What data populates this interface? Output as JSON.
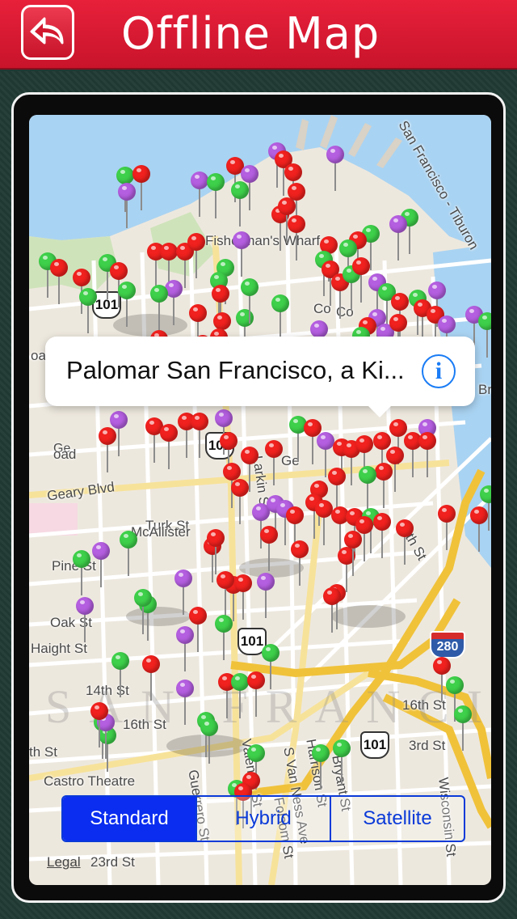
{
  "header": {
    "title": "Offline Map",
    "back_icon": "back-arrow-icon"
  },
  "callout": {
    "title": "Palomar San Francisco, a Ki...",
    "info_icon": "i"
  },
  "segments": [
    {
      "label": "Standard",
      "active": true
    },
    {
      "label": "Hybrid",
      "active": false
    },
    {
      "label": "Satellite",
      "active": false
    }
  ],
  "map": {
    "district_label": "SAN FRANCISCO",
    "legal": "Legal",
    "streets": [
      "Fisherman's Wharf",
      "Pine St",
      "Geary Blvd",
      "Turk St",
      "McAllister",
      "Oak St",
      "Haight St",
      "14th St",
      "16th St",
      "Castro Theatre",
      "23rd St",
      "Guerrero St",
      "Valencia St",
      "S Van Ness Ave",
      "Harrison St",
      "Bryant St",
      "Folsom St",
      "Wisconsin St",
      "San Francisco - Tiburon",
      "16th St",
      "Bro",
      "Larkin St",
      "Ge",
      "Co",
      "th St",
      "5th St",
      "oad",
      "3rd St"
    ],
    "highway_shields": [
      "101",
      "101",
      "101",
      "280"
    ]
  },
  "colors": {
    "header": "#d81a31",
    "pin_red": "#f0211e",
    "pin_green": "#3ed04a",
    "pin_purple": "#b45ee0",
    "segment_blue": "#0a2df0"
  }
}
